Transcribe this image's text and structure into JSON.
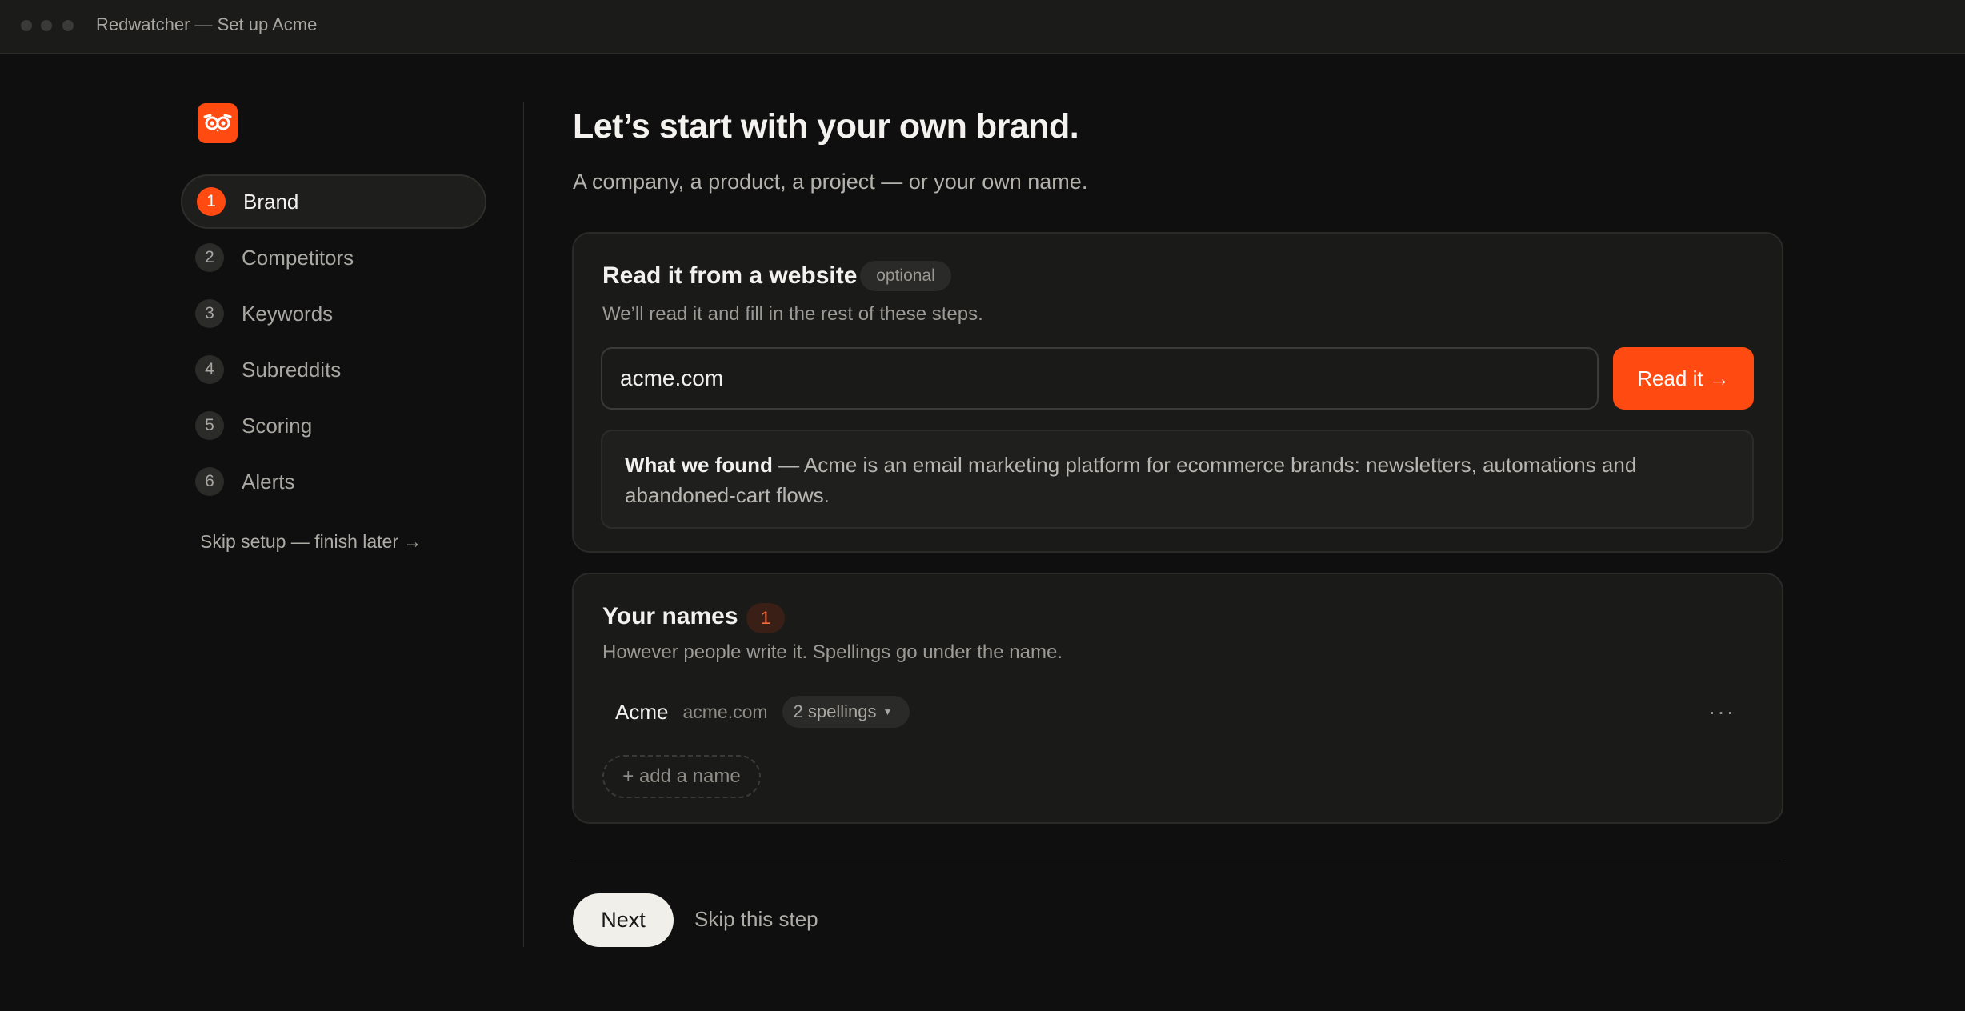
{
  "window": {
    "title": "Redwatcher — Set up Acme"
  },
  "sidebar": {
    "logo_icon": "owl-logo-icon",
    "steps": [
      {
        "number": "1",
        "label": "Brand",
        "active": true
      },
      {
        "number": "2",
        "label": "Competitors",
        "active": false
      },
      {
        "number": "3",
        "label": "Keywords",
        "active": false
      },
      {
        "number": "4",
        "label": "Subreddits",
        "active": false
      },
      {
        "number": "5",
        "label": "Scoring",
        "active": false
      },
      {
        "number": "6",
        "label": "Alerts",
        "active": false
      }
    ],
    "skip_setup": "Skip setup — finish later →"
  },
  "main": {
    "heading": "Let’s start with your own brand.",
    "subheading": "A company, a product, a project — or your own name.",
    "website_card": {
      "title": "Read it from a website",
      "optional_badge": "optional",
      "description": "We’ll read it and fill in the rest of these steps.",
      "url_value": "acme.com",
      "read_button": "Read it →",
      "found_label": "What we found",
      "found_text": " — Acme is an email marketing platform for ecommerce brands: newsletters, automations and abandoned-cart flows."
    },
    "names_card": {
      "title": "Your names",
      "count": "1",
      "description": "However people write it. Spellings go under the name.",
      "names": [
        {
          "name": "Acme",
          "domain": "acme.com",
          "spellings": "2 spellings"
        }
      ],
      "more_icon": "more-horizontal-icon",
      "add_name": "+ add a name"
    },
    "footer": {
      "next": "Next",
      "skip_step": "Skip this step"
    }
  },
  "colors": {
    "accent": "#ff4a12",
    "background": "#0f0f0f",
    "card": "#1a1a19"
  }
}
